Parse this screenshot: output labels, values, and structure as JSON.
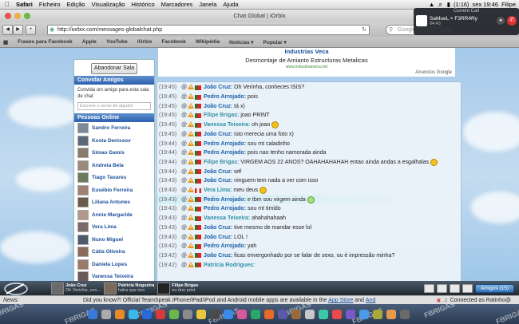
{
  "menubar": {
    "items": [
      "Safari",
      "Ficheiro",
      "Edição",
      "Visualização",
      "Histórico",
      "Marcadores",
      "Janela",
      "Ajuda"
    ],
    "battery": "(1:16)",
    "clock": "sex 19:46",
    "user": "Filipe"
  },
  "browser": {
    "title": "Chat Global | iOrbix",
    "url": "http://iorbix.com/messages-globalchat.php",
    "search_placeholder": "Google",
    "bookmarks": [
      "Frases para Facebook",
      "Apple",
      "YouTube",
      "iOrbix",
      "Facebook",
      "Wikipédia",
      "Notícias ▾",
      "Popular ▾"
    ]
  },
  "ad": {
    "title": "Industrias Veca",
    "subtitle": "Desmontaje de Amianto Estructuras Metalicas",
    "url": "www.industriasveca.net",
    "label": "Anuncios Google"
  },
  "left_panel": {
    "leave_button": "Abandonar Sala",
    "invite_header": "Convidar Amigos",
    "invite_text": "Convida um amigo para esta sala de chat",
    "invite_placeholder": "Escreve o nome de alguém",
    "online_header": "Pessoas Online",
    "people": [
      "Sandro Ferreira",
      "Kosta Denissov",
      "Simao Damis",
      "Andreia Bela",
      "Tiago Tavares",
      "Eusébio Ferreira",
      "Liliana Antunes",
      "Annie Margaride",
      "Vera Lima",
      "Nuno Miguel",
      "Cátia Oliveira",
      "Daniela Lopes",
      "Vanessa Teixeira"
    ]
  },
  "messages": [
    {
      "time": "(19:45)",
      "nick": "João Cruz:",
      "text": "Oh Verinha, conheces ISIS?",
      "cls": "nick-c",
      "flag": "pt",
      "emo": ""
    },
    {
      "time": "(19:45)",
      "nick": "Pedro Arrojado:",
      "text": "pois",
      "cls": "nick-c",
      "flag": "pt",
      "emo": ""
    },
    {
      "time": "(19:45)",
      "nick": "João Cruz:",
      "text": "tá x)",
      "cls": "nick-c",
      "flag": "pt",
      "emo": ""
    },
    {
      "time": "(19:45)",
      "nick": "Filipe Brigas:",
      "text": "joao PRINT",
      "cls": "nick-f",
      "flag": "pt",
      "emo": ""
    },
    {
      "time": "(19:45)",
      "nick": "Vanessa Teixeira:",
      "text": "oh joao",
      "cls": "nick-v",
      "flag": "pt",
      "emo": "y"
    },
    {
      "time": "(19:45)",
      "nick": "João Cruz:",
      "text": "isto merecia uma foto x)",
      "cls": "nick-c",
      "flag": "pt",
      "emo": ""
    },
    {
      "time": "(19:44)",
      "nick": "Pedro Arrojado:",
      "text": "sou mt caladinho",
      "cls": "nick-c",
      "flag": "pt",
      "emo": ""
    },
    {
      "time": "(19:44)",
      "nick": "Pedro Arrojado:",
      "text": "pois nao tenho namorada ainda",
      "cls": "nick-c",
      "flag": "pt",
      "emo": ""
    },
    {
      "time": "(19:44)",
      "nick": "Filipe Brigas:",
      "text": "VIRGEM AOS 22 ANOS? OAHAHAHAHAH entao ainda andas a esgalhalas",
      "cls": "nick-f",
      "flag": "pt",
      "emo": "y"
    },
    {
      "time": "(19:44)",
      "nick": "João Cruz:",
      "text": "wtf",
      "cls": "nick-c",
      "flag": "pt",
      "emo": ""
    },
    {
      "time": "(19:43)",
      "nick": "João Cruz:",
      "text": "ninguem tem nada a ver com isso",
      "cls": "nick-c",
      "flag": "pt",
      "emo": ""
    },
    {
      "time": "(19:43)",
      "nick": "Vera Lima:",
      "text": "meu deus",
      "cls": "nick-v",
      "flag": "ca",
      "emo": "y"
    },
    {
      "time": "(19:43)",
      "nick": "Pedro Arrojado:",
      "text": "e tbm sou virgem ainda",
      "cls": "nick-c",
      "flag": "pt",
      "emo": "g"
    },
    {
      "time": "(19:43)",
      "nick": "Pedro Arrojado:",
      "text": "sou mt timido",
      "cls": "nick-c",
      "flag": "pt",
      "emo": ""
    },
    {
      "time": "(19:43)",
      "nick": "Vanessa Teixeira:",
      "text": "ahahahahaah",
      "cls": "nick-v",
      "flag": "pt",
      "emo": ""
    },
    {
      "time": "(19:43)",
      "nick": "João Cruz:",
      "text": "tive mesmo de mandar esse lol",
      "cls": "nick-c",
      "flag": "pt",
      "emo": ""
    },
    {
      "time": "(19:43)",
      "nick": "João Cruz:",
      "text": "LOL !",
      "cls": "nick-c",
      "flag": "pt",
      "emo": ""
    },
    {
      "time": "(19:42)",
      "nick": "Pedro Arrojado:",
      "text": "yah",
      "cls": "nick-c",
      "flag": "pt",
      "emo": ""
    },
    {
      "time": "(19:42)",
      "nick": "João Cruz:",
      "text": "ficas envergonhado por se falar de sexo, ou é impressão minha?",
      "cls": "nick-c",
      "flag": "pt",
      "emo": ""
    },
    {
      "time": "(19:42)",
      "nick": "Patrícia Rodrigues:",
      "text": "",
      "cls": "nick-v",
      "flag": "pt",
      "emo": ""
    }
  ],
  "chatbar": {
    "conversations": [
      {
        "name": "João Cruz",
        "preview": "Oh Verinha, con..."
      },
      {
        "name": "Patricia Nogueira",
        "preview": "haha que rico"
      },
      {
        "name": "Filipe Brigas",
        "preview": "eu duo print"
      }
    ],
    "friends_button": "Amigos (15)"
  },
  "news": {
    "label": "News:",
    "text": "Did you know?! Official TeamSpeak iPhone/iPad/iPod and Android mobile apps are available in the",
    "link1": "App Store",
    "and": "and",
    "link2": "And",
    "status": "Connected as Ratinho@"
  },
  "notification": {
    "title": "Current Call",
    "caller": "SaMueL × F3RR4Ry",
    "duration": "04:43"
  },
  "dock": {
    "watermark": "FBRIGAS"
  },
  "colors": {
    "link": "#1a5fa8",
    "header": "#2d61b0"
  }
}
